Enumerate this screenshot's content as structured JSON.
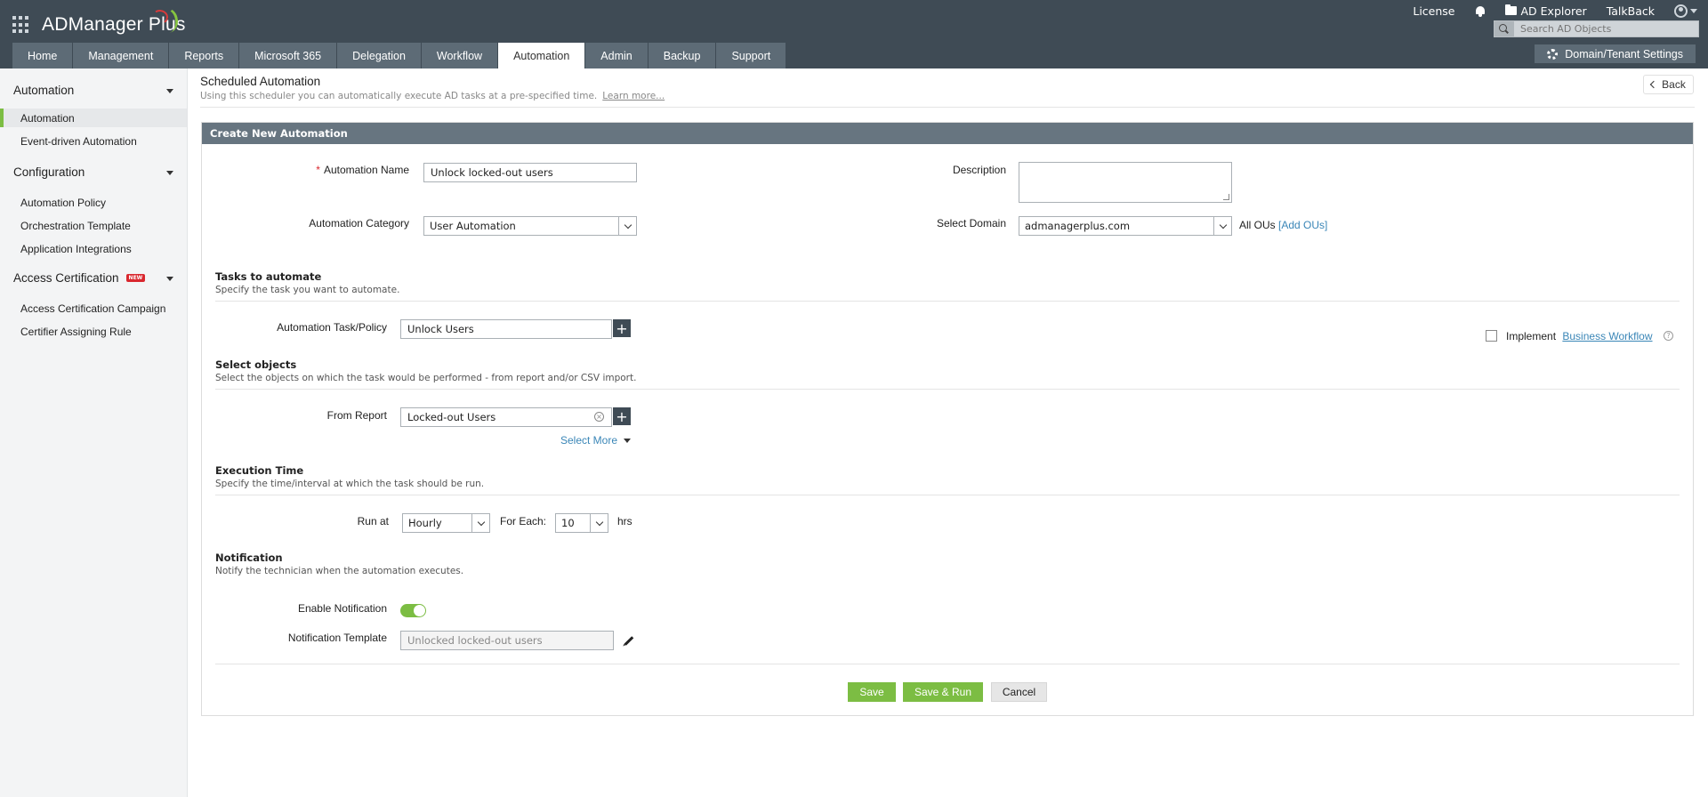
{
  "header": {
    "logo": "ADManager Plus",
    "links": {
      "license": "License",
      "ad_explorer": "AD Explorer",
      "talkback": "TalkBack"
    },
    "search_placeholder": "Search AD Objects",
    "domain_settings": "Domain/Tenant Settings",
    "tabs": [
      {
        "label": "Home"
      },
      {
        "label": "Management"
      },
      {
        "label": "Reports"
      },
      {
        "label": "Microsoft 365"
      },
      {
        "label": "Delegation"
      },
      {
        "label": "Workflow"
      },
      {
        "label": "Automation",
        "active": true
      },
      {
        "label": "Admin"
      },
      {
        "label": "Backup"
      },
      {
        "label": "Support"
      }
    ]
  },
  "sidebar": {
    "groups": [
      {
        "label": "Automation"
      },
      {
        "label": "Configuration"
      },
      {
        "label": "Access Certification",
        "badge": "NEW"
      }
    ],
    "items": [
      {
        "label": "Automation",
        "active": true
      },
      {
        "label": "Event-driven Automation"
      },
      {
        "label": "Automation Policy"
      },
      {
        "label": "Orchestration Template"
      },
      {
        "label": "Application Integrations"
      },
      {
        "label": "Access Certification Campaign"
      },
      {
        "label": "Certifier Assigning Rule"
      }
    ]
  },
  "page": {
    "title": "Scheduled Automation",
    "subtitle": "Using this scheduler you can automatically execute AD tasks at a pre-specified time.",
    "learn_more": "Learn more...",
    "back": "Back"
  },
  "form": {
    "panel_title": "Create New Automation",
    "name_label": "Automation Name",
    "name_value": "Unlock locked-out users",
    "description_label": "Description",
    "category_label": "Automation Category",
    "category_value": "User Automation",
    "domain_label": "Select Domain",
    "domain_value": "admanagerplus.com",
    "all_ous": "All OUs",
    "add_ous": "[Add OUs]",
    "tasks": {
      "title": "Tasks to automate",
      "subtitle": "Specify the task you want to automate.",
      "task_label": "Automation Task/Policy",
      "task_value": "Unlock Users",
      "implement": "Implement",
      "business_workflow": "Business Workflow"
    },
    "objects": {
      "title": "Select objects",
      "subtitle": "Select the objects on which the task would be performed - from report and/or CSV import.",
      "report_label": "From Report",
      "report_value": "Locked-out Users",
      "select_more": "Select More"
    },
    "execution": {
      "title": "Execution Time",
      "subtitle": "Specify the time/interval at which the task should be run.",
      "run_at_label": "Run at",
      "run_at_value": "Hourly",
      "for_each_label": "For Each:",
      "for_each_value": "10",
      "unit": "hrs"
    },
    "notification": {
      "title": "Notification",
      "subtitle": "Notify the technician when the automation executes.",
      "enable_label": "Enable Notification",
      "enabled": true,
      "template_label": "Notification Template",
      "template_placeholder": "Unlocked locked-out users"
    },
    "buttons": {
      "save": "Save",
      "save_run": "Save & Run",
      "cancel": "Cancel"
    }
  }
}
